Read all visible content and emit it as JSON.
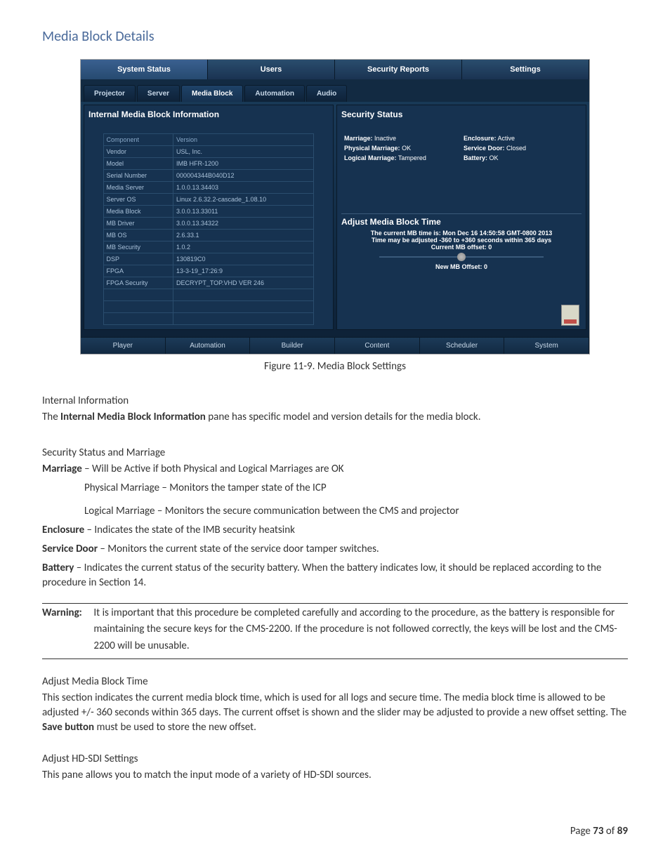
{
  "header": {
    "title": "Media Block Details"
  },
  "screenshot": {
    "topTabs": [
      "System Status",
      "Users",
      "Security Reports",
      "Settings"
    ],
    "topTabActiveIndex": 0,
    "subTabs": [
      "Projector",
      "Server",
      "Media Block",
      "Automation",
      "Audio"
    ],
    "subTabActiveIndex": 2,
    "leftPanel": {
      "title": "Internal Media Block Information",
      "columns": [
        "Component",
        "Version"
      ],
      "rows": [
        [
          "Vendor",
          "USL, Inc."
        ],
        [
          "Model",
          "IMB HFR-1200"
        ],
        [
          "Serial Number",
          "000004344B040D12"
        ],
        [
          "Media Server",
          "1.0.0.13.34403"
        ],
        [
          "Server OS",
          "Linux 2.6.32.2-cascade_1.08.10"
        ],
        [
          "Media Block",
          "3.0.0.13.33011"
        ],
        [
          "MB Driver",
          "3.0.0.13.34322"
        ],
        [
          "MB OS",
          "2.6.33.1"
        ],
        [
          "MB Security",
          "1.0.2"
        ],
        [
          "DSP",
          "130819C0"
        ],
        [
          "FPGA",
          "13-3-19_17:26:9"
        ],
        [
          "FPGA Security",
          "DECRYPT_TOP.VHD VER 246"
        ]
      ]
    },
    "rightPanel": {
      "title": "Security Status",
      "securityItems": [
        {
          "label": "Marriage:",
          "value": "Inactive"
        },
        {
          "label": "Enclosure:",
          "value": "Active"
        },
        {
          "label": "Physical Marriage:",
          "value": "OK"
        },
        {
          "label": "Service Door:",
          "value": "Closed"
        },
        {
          "label": "Logical Marriage:",
          "value": "Tampered"
        },
        {
          "label": "Battery:",
          "value": "OK"
        }
      ],
      "adjust": {
        "title": "Adjust Media Block Time",
        "line1": "The current MB time is: Mon Dec 16 14:50:58 GMT-0800 2013",
        "line2": "Time may be adjusted -360 to +360 seconds within 365 days",
        "line3": "Current MB offset: 0",
        "line4": "New MB Offset: 0"
      }
    },
    "bottomTabs": [
      "Player",
      "Automation",
      "Builder",
      "Content",
      "Scheduler",
      "System"
    ]
  },
  "figureCaption": "Figure 11-9.  Media Block Settings",
  "sections": {
    "internal": {
      "head": "Internal Information",
      "p1a": "The ",
      "p1b": "Internal Media Block Information",
      "p1c": " pane has specific model and version details for the media block."
    },
    "security": {
      "head": "Security Status and Marriage",
      "marriage_b": "Marriage",
      "marriage_t": " – Will be Active if both Physical and Logical Marriages are OK",
      "phys": "Physical Marriage – Monitors the tamper state of the ICP",
      "logi": "Logical Marriage – Monitors the secure communication between the CMS and projector",
      "enc_b": "Enclosure",
      "enc_t": " – Indicates the state of the IMB security heatsink",
      "svc_b": "Service Door",
      "svc_t": " – Monitors the current state of the service door tamper switches.",
      "bat_b": "Battery",
      "bat_t": " – Indicates the current status of the security battery.  When the battery indicates low, it should be replaced according to the procedure in Section 14."
    },
    "warning": {
      "label": "Warning:",
      "body": "It is important that this procedure be completed carefully and according to the procedure, as the battery is responsible for maintaining the secure keys for the CMS-2200.  If the procedure is not followed correctly, the keys will be lost and the CMS-2200 will be unusable."
    },
    "adjust": {
      "head": "Adjust Media Block Time",
      "p_a": "This section indicates the current media block time, which is used for all logs and secure time.  The media block time is allowed to be adjusted +/- 360 seconds within 365 days.  The current offset is shown and the slider may be adjusted to provide a new offset setting.  The ",
      "p_b": "Save button",
      "p_c": " must be used to store the new offset."
    },
    "hdsdi": {
      "head": "Adjust HD-SDI Settings",
      "p": "This pane allows you to match the input mode of a variety of HD-SDI sources."
    }
  },
  "footer": {
    "pre": "Page ",
    "num": "73",
    "mid": " of ",
    "total": "89"
  }
}
